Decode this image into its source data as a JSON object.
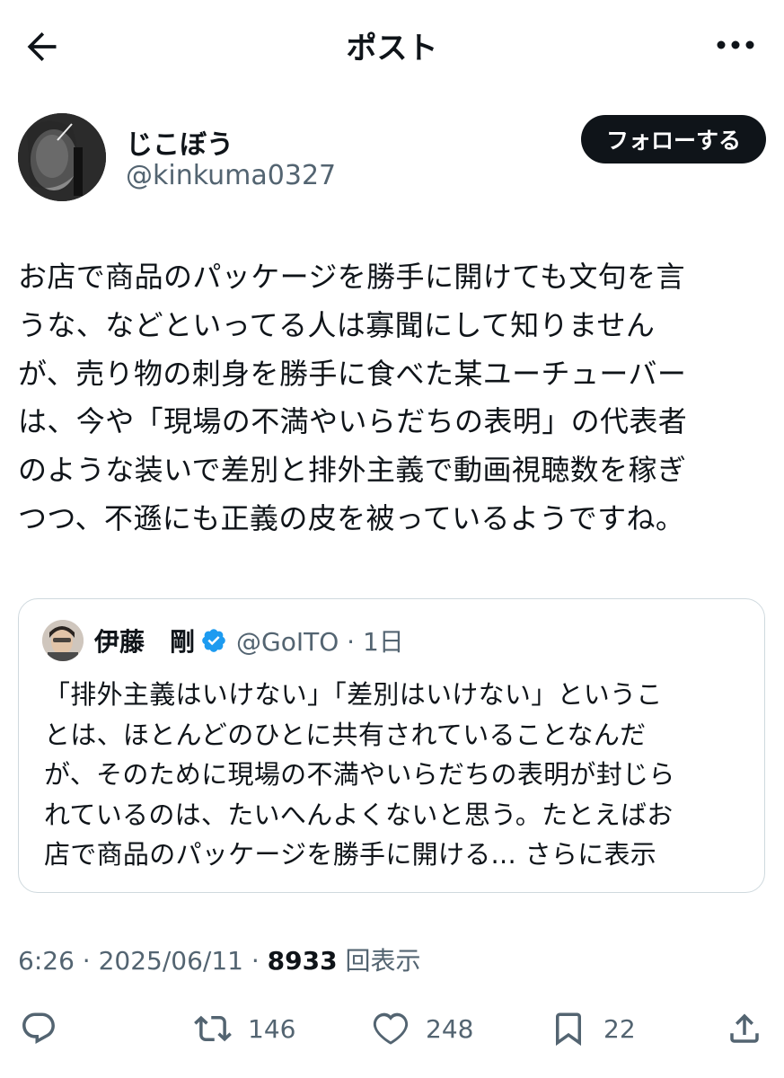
{
  "header": {
    "title": "ポスト",
    "back_icon": "arrow-left-icon",
    "more_icon": "more-horizontal-icon"
  },
  "author": {
    "display_name": "じこぼう",
    "handle": "@kinkuma0327",
    "follow_label": "フォローする"
  },
  "post": {
    "lines": [
      "お店で商品のパッケージを勝手に開けても文句を言",
      "うな、などといってる人は寡聞にして知りません",
      "が、売り物の刺身を勝手に食べた某ユーチューバー",
      "は、今や「現場の不満やいらだちの表明」の代表者",
      "のような装いで差別と排外主義で動画視聴数を稼ぎ",
      "つつ、不遜にも正義の皮を被っているようですね。"
    ]
  },
  "quote": {
    "name": "伊藤　剛",
    "verified_icon": "verified-badge-icon",
    "handle_time": "@GoITO · 1日",
    "lines": [
      "「排外主義はいけない」「差別はいけない」というこ",
      "とは、ほとんどのひとに共有されていることなんだ",
      "が、そのために現場の不満やいらだちの表明が封じら",
      "れているのは、たいへんよくないと思う。たとえばお"
    ],
    "last_line": "店で商品のパッケージを勝手に開ける...",
    "show_more": " さらに表示"
  },
  "meta": {
    "time": "6:26 · 2025/06/11 · ",
    "views": "8933",
    "views_label": " 回表示"
  },
  "actions": {
    "reply_icon": "reply-icon",
    "retweet_icon": "retweet-icon",
    "retweets": "146",
    "like_icon": "heart-icon",
    "likes": "248",
    "bookmark_icon": "bookmark-icon",
    "bookmarks": "22",
    "share_icon": "share-icon"
  },
  "colors": {
    "text": "#0f1419",
    "secondary": "#536471",
    "border": "#cfd9de",
    "verified": "#1d9bf0",
    "button": "#0f1419"
  }
}
